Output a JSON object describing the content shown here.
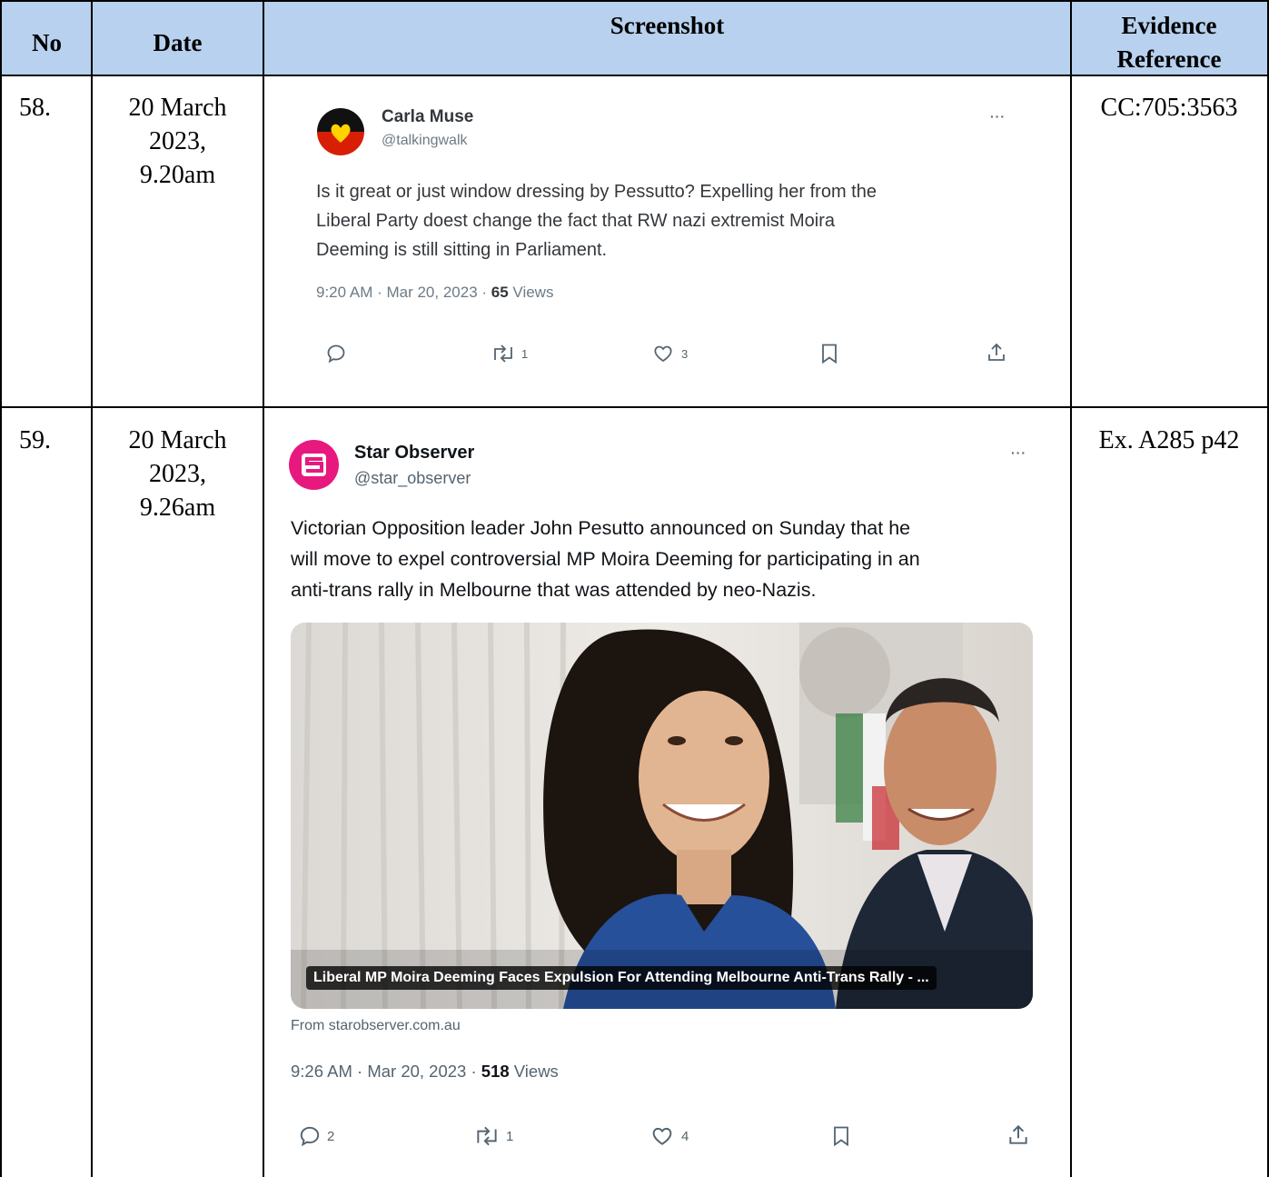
{
  "headers": {
    "no": "No",
    "date": "Date",
    "screenshot": "Screenshot",
    "evidence_line1": "Evidence",
    "evidence_line2": "Reference"
  },
  "rows": [
    {
      "no": "58.",
      "date_line1": "20 March",
      "date_line2": "2023,",
      "date_line3": "9.20am",
      "evidence": "CC:705:3563",
      "tweet": {
        "name": "Carla Muse",
        "handle": "@talkingwalk",
        "avatar_icon": "aboriginal-flag-heart-icon",
        "text_line1": "Is it great or just window dressing by Pessutto? Expelling her from the",
        "text_line2": "Liberal Party doest change the fact that RW nazi extremist Moira",
        "text_line3": "Deeming is still sitting in Parliament.",
        "meta_time": "9:20 AM · Mar 20, 2023 · ",
        "views": "65",
        "views_label": " Views",
        "more": "···",
        "reposts": "1",
        "likes": "3"
      }
    },
    {
      "no": "59.",
      "date_line1": "20 March",
      "date_line2": "2023,",
      "date_line3": "9.26am",
      "evidence": "Ex. A285 p42",
      "tweet": {
        "name": "Star Observer",
        "handle": "@star_observer",
        "avatar_icon": "star-observer-logo-icon",
        "text_line1": "Victorian Opposition leader John Pesutto announced on Sunday that he",
        "text_line2": "will move to expel controversial MP Moira Deeming for participating in an",
        "text_line3": "anti-trans rally in Melbourne that was attended by neo-Nazis.",
        "card_caption": "Liberal MP Moira Deeming Faces Expulsion For Attending Melbourne Anti-Trans Rally - ...",
        "card_source": "From starobserver.com.au",
        "meta_time": "9:26 AM · Mar 20, 2023 · ",
        "views": "518",
        "views_label": " Views",
        "more": "···",
        "replies": "2",
        "reposts": "1",
        "likes": "4"
      }
    }
  ]
}
